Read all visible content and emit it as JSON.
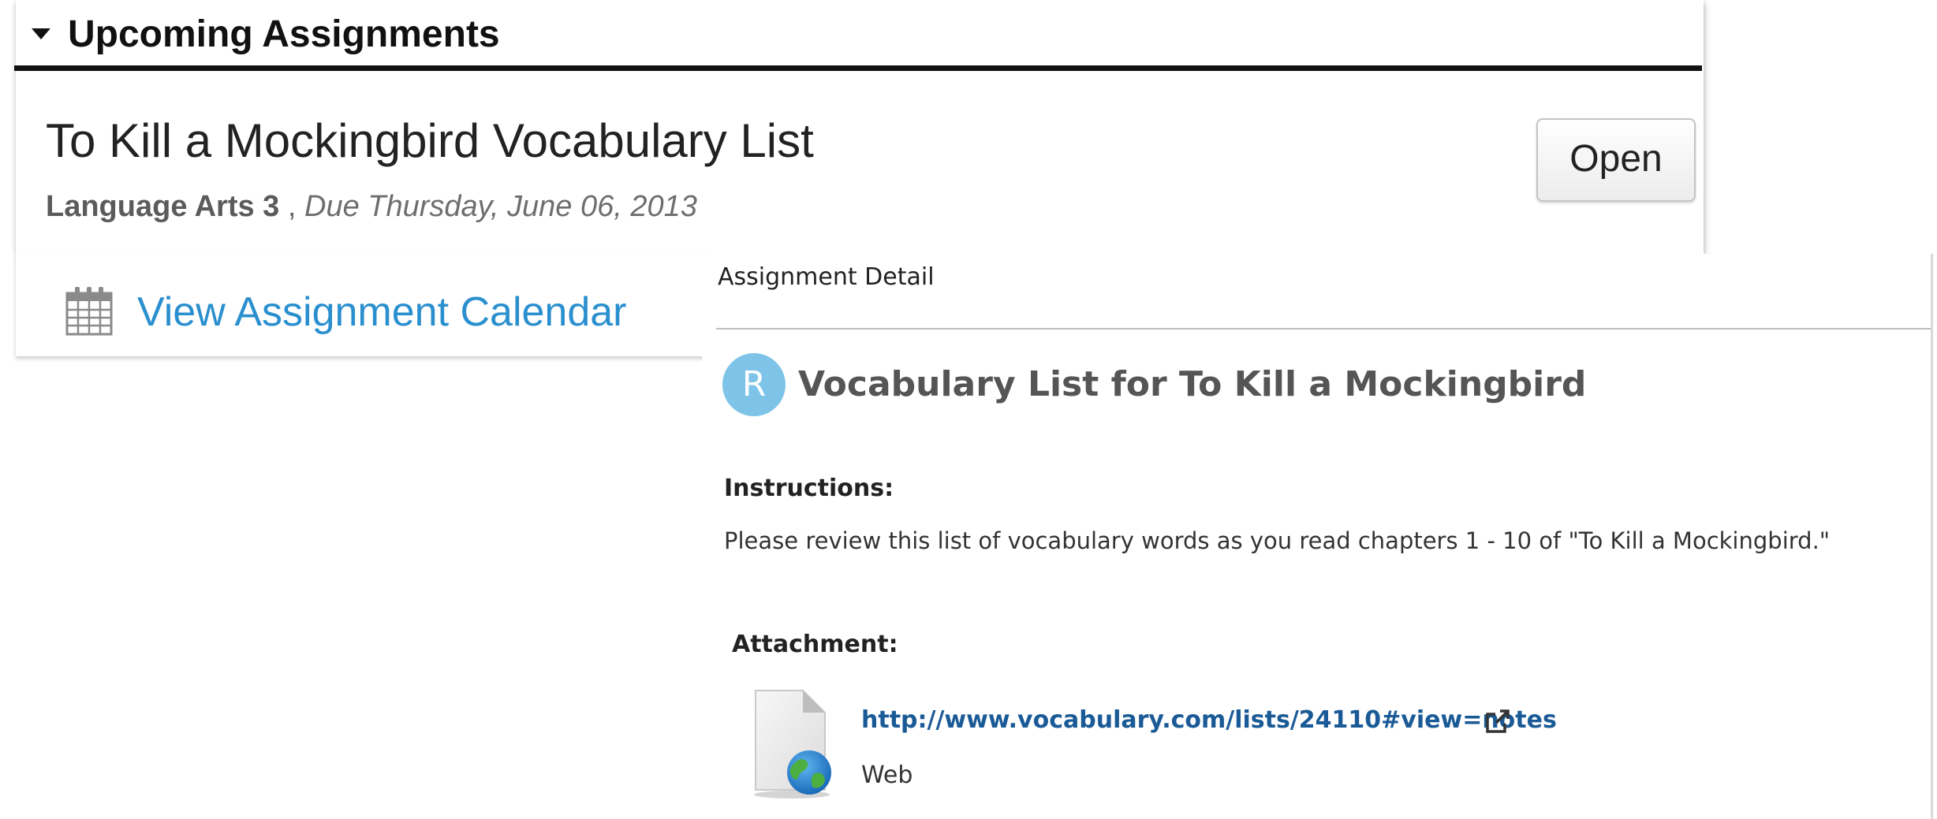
{
  "upcoming": {
    "title": "Upcoming Assignments",
    "assignment": {
      "title": "To Kill a Mockingbird Vocabulary List",
      "course": "Language Arts 3",
      "separator": " , ",
      "due": "Due Thursday, June 06, 2013",
      "open_label": "Open"
    },
    "calendar_link": "View Assignment Calendar"
  },
  "detail": {
    "header": "Assignment Detail",
    "badge_letter": "R",
    "title": "Vocabulary List for To Kill a Mockingbird",
    "instructions_label": "Instructions:",
    "instructions_text": "Please review this list of vocabulary words as you read chapters 1 - 10 of \"To Kill a Mockingbird.\"",
    "attachment_label": "Attachment:",
    "attachment": {
      "url": "http://www.vocabulary.com/lists/24110#view=notes",
      "type": "Web",
      "icon": "web-file-icon",
      "link_icon": "external-link-icon"
    }
  },
  "colors": {
    "link_blue": "#2a8fce",
    "attachment_link": "#1a5a96",
    "badge": "#7ec3e8",
    "header_rule": "#111111"
  }
}
